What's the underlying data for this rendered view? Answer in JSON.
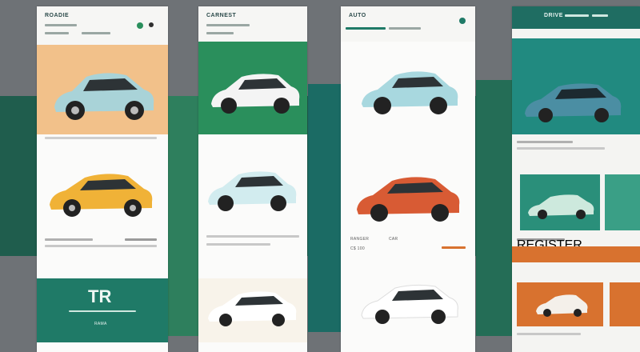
{
  "colors": {
    "teal": "#1f7a67",
    "green": "#2a8f5c",
    "orange": "#d8722f",
    "cream": "#f8f3ea",
    "sky": "#a8d8df",
    "yellow": "#f0b237",
    "red": "#d85b34"
  },
  "screens": [
    {
      "brand": "ROADIE",
      "hero_logo": "TR",
      "footer_text": "RAMA"
    },
    {
      "brand": "CARNEST"
    },
    {
      "brand": "AUTO",
      "labels": [
        "RANGER",
        "CAR"
      ],
      "price": "C$ 100"
    },
    {
      "brand": "DRIVE",
      "section": "REGISTER"
    }
  ]
}
